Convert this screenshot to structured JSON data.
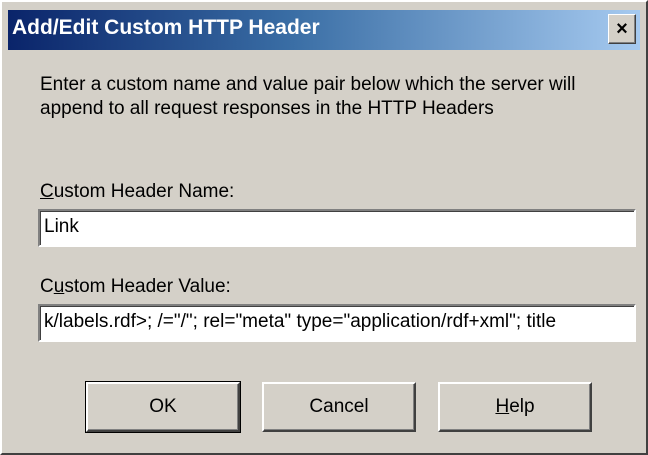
{
  "dialog": {
    "title": "Add/Edit Custom HTTP Header",
    "close_glyph": "×",
    "description": "Enter a custom name and value pair below which the server will append to all request responses in the HTTP Headers",
    "name_label": {
      "accel": "C",
      "rest": "ustom Header Name:"
    },
    "name_value": "Link",
    "value_label": {
      "pre": "C",
      "accel": "u",
      "rest": "stom Header Value:"
    },
    "value_value": "k/labels.rdf>; /=\"/\"; rel=\"meta\" type=\"application/rdf+xml\"; title",
    "buttons": {
      "ok": "OK",
      "cancel": "Cancel",
      "help": {
        "accel": "H",
        "rest": "elp"
      }
    }
  }
}
